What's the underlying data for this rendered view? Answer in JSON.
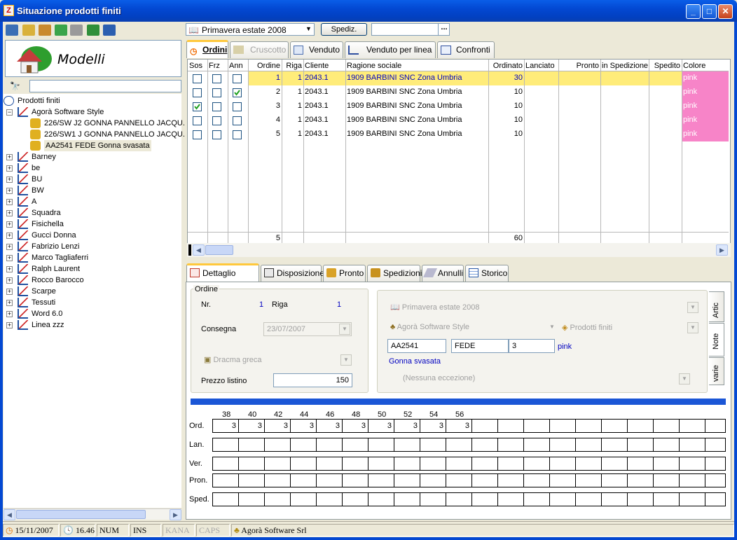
{
  "window": {
    "title": "Situazione prodotti finiti",
    "app_icon_glyph": "Z"
  },
  "left": {
    "panel_title": "Modelli",
    "search_value": "",
    "tree": [
      {
        "label": "Prodotti finiti",
        "level": 0,
        "expander": ""
      },
      {
        "label": "Agorà Software Style",
        "level": 1,
        "expander": "−"
      },
      {
        "label": "226/SW J2 GONNA PANNELLO JACQU.",
        "level": 2,
        "expander": ""
      },
      {
        "label": "226/SW1 J GONNA PANNELLO JACQU.",
        "level": 2,
        "expander": ""
      },
      {
        "label": "AA2541 FEDE Gonna svasata",
        "level": 2,
        "expander": "",
        "selected": true
      },
      {
        "label": "Barney",
        "level": 1,
        "expander": "+"
      },
      {
        "label": "be",
        "level": 1,
        "expander": "+"
      },
      {
        "label": "BU",
        "level": 1,
        "expander": "+"
      },
      {
        "label": "BW",
        "level": 1,
        "expander": "+"
      },
      {
        "label": "A",
        "level": 1,
        "expander": "+"
      },
      {
        "label": "Squadra",
        "level": 1,
        "expander": "+"
      },
      {
        "label": "Fisichella",
        "level": 1,
        "expander": "+"
      },
      {
        "label": "Gucci Donna",
        "level": 1,
        "expander": "+"
      },
      {
        "label": "Fabrizio Lenzi",
        "level": 1,
        "expander": "+"
      },
      {
        "label": "Marco Tagliaferri",
        "level": 1,
        "expander": "+"
      },
      {
        "label": "Ralph Laurent",
        "level": 1,
        "expander": "+"
      },
      {
        "label": "Rocco Barocco",
        "level": 1,
        "expander": "+"
      },
      {
        "label": "Scarpe",
        "level": 1,
        "expander": "+"
      },
      {
        "label": "Tessuti",
        "level": 1,
        "expander": "+"
      },
      {
        "label": "Word 6.0",
        "level": 1,
        "expander": "+"
      },
      {
        "label": "Linea zzz",
        "level": 1,
        "expander": "+"
      }
    ]
  },
  "top": {
    "season": "Primavera estate 2008",
    "spediz_label": "Spediz.",
    "spediz_value": "",
    "ellipsis": "..."
  },
  "tabs": [
    {
      "label": "Ordini",
      "active": true,
      "disabled": false
    },
    {
      "label": "Cruscotto",
      "active": false,
      "disabled": true
    },
    {
      "label": "Venduto",
      "active": false,
      "disabled": false
    },
    {
      "label": "Venduto per linea",
      "active": false,
      "disabled": false
    },
    {
      "label": "Confronti",
      "active": false,
      "disabled": false
    }
  ],
  "grid": {
    "headers": [
      "Sos",
      "Frz",
      "Ann",
      "Ordine",
      "Riga",
      "Cliente",
      "Ragione sociale",
      "Ordinato",
      "Lanciato",
      "Pronto",
      "in Spedizione",
      "Spedito",
      "Colore"
    ],
    "rows": [
      {
        "sos": false,
        "frz": false,
        "ann": false,
        "ordine": "1",
        "riga": "1",
        "cliente": "2043.1",
        "ragione": "1909 BARBINI SNC Zona Umbria",
        "ordinato": "30",
        "colore": "pink",
        "selected": true
      },
      {
        "sos": false,
        "frz": false,
        "ann": true,
        "ordine": "2",
        "riga": "1",
        "cliente": "2043.1",
        "ragione": "1909 BARBINI SNC Zona Umbria",
        "ordinato": "10",
        "colore": "pink",
        "selected": false
      },
      {
        "sos": true,
        "frz": false,
        "ann": false,
        "ordine": "3",
        "riga": "1",
        "cliente": "2043.1",
        "ragione": "1909 BARBINI SNC Zona Umbria",
        "ordinato": "10",
        "colore": "pink",
        "selected": false
      },
      {
        "sos": false,
        "frz": false,
        "ann": false,
        "ordine": "4",
        "riga": "1",
        "cliente": "2043.1",
        "ragione": "1909 BARBINI SNC Zona Umbria",
        "ordinato": "10",
        "colore": "pink",
        "selected": false
      },
      {
        "sos": false,
        "frz": false,
        "ann": false,
        "ordine": "5",
        "riga": "1",
        "cliente": "2043.1",
        "ragione": "1909 BARBINI SNC Zona Umbria",
        "ordinato": "10",
        "colore": "pink",
        "selected": false
      }
    ],
    "totals": {
      "ordine": "5",
      "ordinato": "60"
    }
  },
  "detail_tabs": [
    {
      "label": "Dettaglio ordine",
      "active": true
    },
    {
      "label": "Disposizione",
      "active": false
    },
    {
      "label": "Pronto",
      "active": false
    },
    {
      "label": "Spedizioni",
      "active": false
    },
    {
      "label": "Annulli",
      "active": false
    },
    {
      "label": "Storico",
      "active": false
    }
  ],
  "ordine": {
    "group_label": "Ordine",
    "nr_label": "Nr.",
    "nr_value": "1",
    "riga_label": "Riga",
    "riga_value": "1",
    "consegna_label": "Consegna",
    "consegna_value": "23/07/2007",
    "currency": "Dracma greca",
    "prezzo_label": "Prezzo listino",
    "prezzo_value": "150"
  },
  "articolo": {
    "season": "Primavera estate 2008",
    "company": "Agorà Software Style",
    "category": "Prodotti finiti",
    "code": "AA2541",
    "name": "FEDE",
    "variant": "3",
    "color": "pink",
    "description": "Gonna svasata",
    "exception": "(Nessuna eccezione)",
    "side_tabs": [
      "Artic",
      "Note",
      "varie"
    ]
  },
  "sizes": {
    "labels": [
      "38",
      "40",
      "42",
      "44",
      "46",
      "48",
      "50",
      "52",
      "54",
      "56"
    ],
    "row_labels": [
      "Ord.",
      "Lan.",
      "Ver.",
      "Pron.",
      "Sped."
    ],
    "ord_values": [
      "3",
      "3",
      "3",
      "3",
      "3",
      "3",
      "3",
      "3",
      "3",
      "3"
    ]
  },
  "status": {
    "date": "15/11/2007",
    "time": "16.46",
    "num": "NUM",
    "ins": "INS",
    "kana": "KANA",
    "caps": "CAPS",
    "company": "Agorà Software Srl"
  },
  "colors": {
    "accent": "#0348d2",
    "selected_row": "#ffec7a",
    "pink": "#f784c8",
    "link_blue": "#0000c0"
  }
}
